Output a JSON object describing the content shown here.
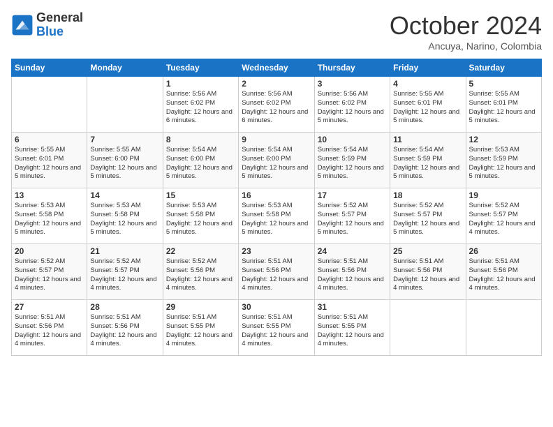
{
  "header": {
    "logo_line1": "General",
    "logo_line2": "Blue",
    "month": "October 2024",
    "location": "Ancuya, Narino, Colombia"
  },
  "weekdays": [
    "Sunday",
    "Monday",
    "Tuesday",
    "Wednesday",
    "Thursday",
    "Friday",
    "Saturday"
  ],
  "weeks": [
    [
      {
        "day": "",
        "info": ""
      },
      {
        "day": "",
        "info": ""
      },
      {
        "day": "1",
        "info": "Sunrise: 5:56 AM\nSunset: 6:02 PM\nDaylight: 12 hours and 6 minutes."
      },
      {
        "day": "2",
        "info": "Sunrise: 5:56 AM\nSunset: 6:02 PM\nDaylight: 12 hours and 6 minutes."
      },
      {
        "day": "3",
        "info": "Sunrise: 5:56 AM\nSunset: 6:02 PM\nDaylight: 12 hours and 5 minutes."
      },
      {
        "day": "4",
        "info": "Sunrise: 5:55 AM\nSunset: 6:01 PM\nDaylight: 12 hours and 5 minutes."
      },
      {
        "day": "5",
        "info": "Sunrise: 5:55 AM\nSunset: 6:01 PM\nDaylight: 12 hours and 5 minutes."
      }
    ],
    [
      {
        "day": "6",
        "info": "Sunrise: 5:55 AM\nSunset: 6:01 PM\nDaylight: 12 hours and 5 minutes."
      },
      {
        "day": "7",
        "info": "Sunrise: 5:55 AM\nSunset: 6:00 PM\nDaylight: 12 hours and 5 minutes."
      },
      {
        "day": "8",
        "info": "Sunrise: 5:54 AM\nSunset: 6:00 PM\nDaylight: 12 hours and 5 minutes."
      },
      {
        "day": "9",
        "info": "Sunrise: 5:54 AM\nSunset: 6:00 PM\nDaylight: 12 hours and 5 minutes."
      },
      {
        "day": "10",
        "info": "Sunrise: 5:54 AM\nSunset: 5:59 PM\nDaylight: 12 hours and 5 minutes."
      },
      {
        "day": "11",
        "info": "Sunrise: 5:54 AM\nSunset: 5:59 PM\nDaylight: 12 hours and 5 minutes."
      },
      {
        "day": "12",
        "info": "Sunrise: 5:53 AM\nSunset: 5:59 PM\nDaylight: 12 hours and 5 minutes."
      }
    ],
    [
      {
        "day": "13",
        "info": "Sunrise: 5:53 AM\nSunset: 5:58 PM\nDaylight: 12 hours and 5 minutes."
      },
      {
        "day": "14",
        "info": "Sunrise: 5:53 AM\nSunset: 5:58 PM\nDaylight: 12 hours and 5 minutes."
      },
      {
        "day": "15",
        "info": "Sunrise: 5:53 AM\nSunset: 5:58 PM\nDaylight: 12 hours and 5 minutes."
      },
      {
        "day": "16",
        "info": "Sunrise: 5:53 AM\nSunset: 5:58 PM\nDaylight: 12 hours and 5 minutes."
      },
      {
        "day": "17",
        "info": "Sunrise: 5:52 AM\nSunset: 5:57 PM\nDaylight: 12 hours and 5 minutes."
      },
      {
        "day": "18",
        "info": "Sunrise: 5:52 AM\nSunset: 5:57 PM\nDaylight: 12 hours and 5 minutes."
      },
      {
        "day": "19",
        "info": "Sunrise: 5:52 AM\nSunset: 5:57 PM\nDaylight: 12 hours and 4 minutes."
      }
    ],
    [
      {
        "day": "20",
        "info": "Sunrise: 5:52 AM\nSunset: 5:57 PM\nDaylight: 12 hours and 4 minutes."
      },
      {
        "day": "21",
        "info": "Sunrise: 5:52 AM\nSunset: 5:57 PM\nDaylight: 12 hours and 4 minutes."
      },
      {
        "day": "22",
        "info": "Sunrise: 5:52 AM\nSunset: 5:56 PM\nDaylight: 12 hours and 4 minutes."
      },
      {
        "day": "23",
        "info": "Sunrise: 5:51 AM\nSunset: 5:56 PM\nDaylight: 12 hours and 4 minutes."
      },
      {
        "day": "24",
        "info": "Sunrise: 5:51 AM\nSunset: 5:56 PM\nDaylight: 12 hours and 4 minutes."
      },
      {
        "day": "25",
        "info": "Sunrise: 5:51 AM\nSunset: 5:56 PM\nDaylight: 12 hours and 4 minutes."
      },
      {
        "day": "26",
        "info": "Sunrise: 5:51 AM\nSunset: 5:56 PM\nDaylight: 12 hours and 4 minutes."
      }
    ],
    [
      {
        "day": "27",
        "info": "Sunrise: 5:51 AM\nSunset: 5:56 PM\nDaylight: 12 hours and 4 minutes."
      },
      {
        "day": "28",
        "info": "Sunrise: 5:51 AM\nSunset: 5:56 PM\nDaylight: 12 hours and 4 minutes."
      },
      {
        "day": "29",
        "info": "Sunrise: 5:51 AM\nSunset: 5:55 PM\nDaylight: 12 hours and 4 minutes."
      },
      {
        "day": "30",
        "info": "Sunrise: 5:51 AM\nSunset: 5:55 PM\nDaylight: 12 hours and 4 minutes."
      },
      {
        "day": "31",
        "info": "Sunrise: 5:51 AM\nSunset: 5:55 PM\nDaylight: 12 hours and 4 minutes."
      },
      {
        "day": "",
        "info": ""
      },
      {
        "day": "",
        "info": ""
      }
    ]
  ]
}
